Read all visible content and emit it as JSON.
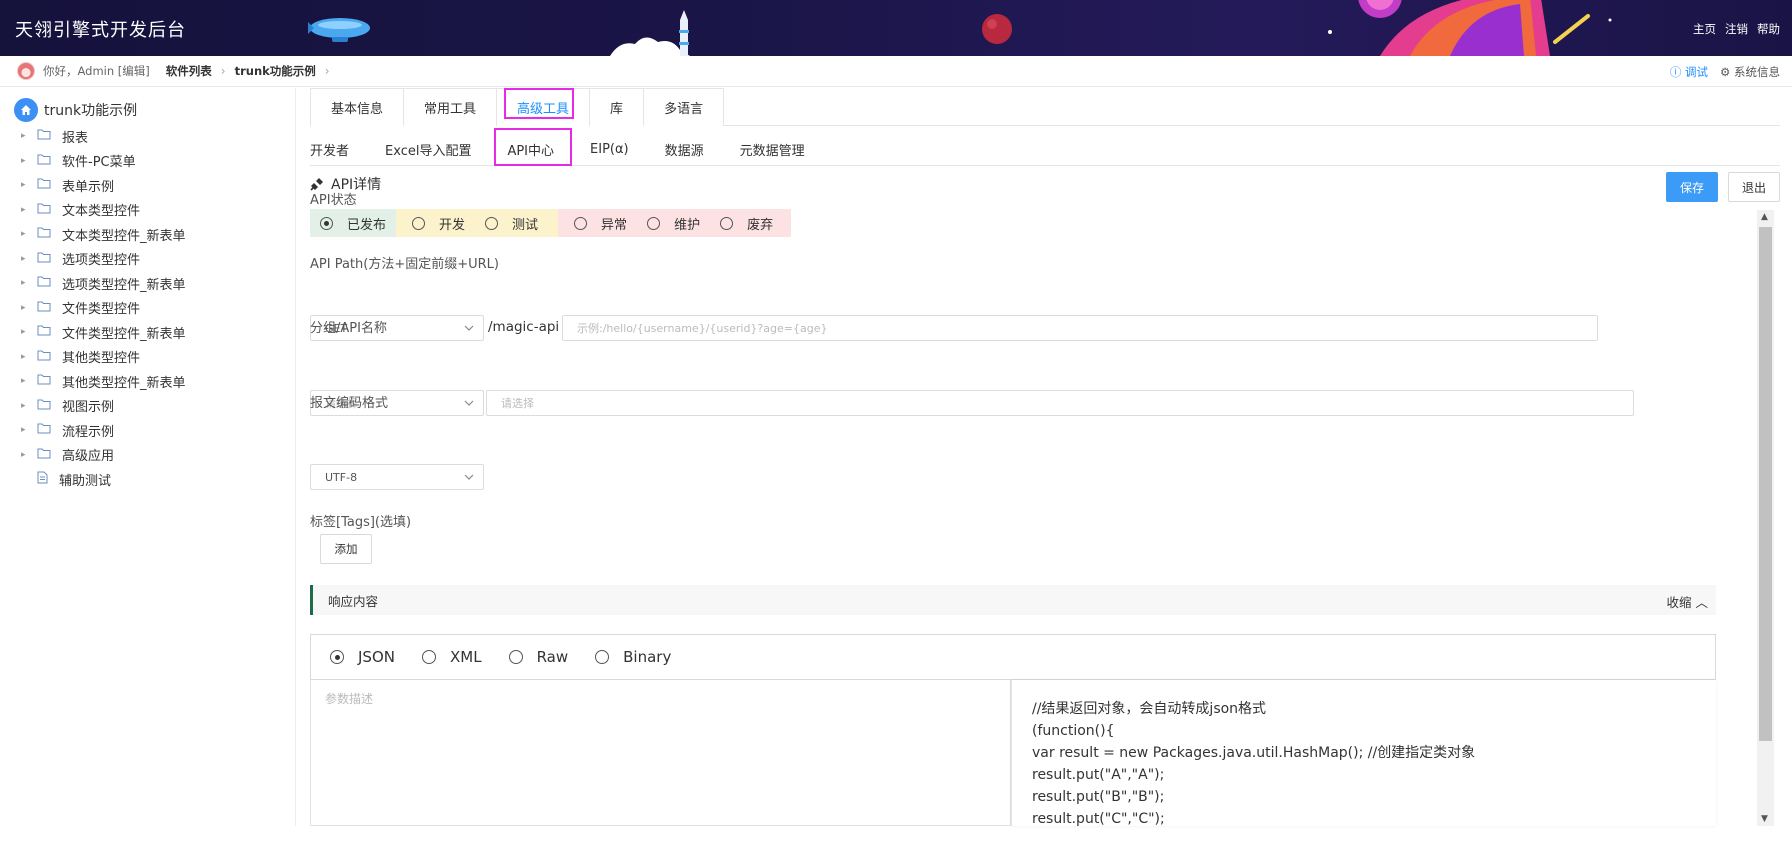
{
  "header": {
    "title": "天翎引擎式开发后台",
    "links": [
      "主页",
      "注销",
      "帮助"
    ]
  },
  "crumbbar": {
    "greeting": "你好，Admin [编辑]",
    "crumbs": [
      "软件列表",
      "trunk功能示例"
    ],
    "debug": "调试",
    "sysinfo": "系统信息"
  },
  "sidebar": {
    "root": "trunk功能示例",
    "items": [
      {
        "label": "报表",
        "type": "folder"
      },
      {
        "label": "软件-PC菜单",
        "type": "folder"
      },
      {
        "label": "表单示例",
        "type": "folder"
      },
      {
        "label": "文本类型控件",
        "type": "folder"
      },
      {
        "label": "文本类型控件_新表单",
        "type": "folder"
      },
      {
        "label": "选项类型控件",
        "type": "folder"
      },
      {
        "label": "选项类型控件_新表单",
        "type": "folder"
      },
      {
        "label": "文件类型控件",
        "type": "folder"
      },
      {
        "label": "文件类型控件_新表单",
        "type": "folder"
      },
      {
        "label": "其他类型控件",
        "type": "folder"
      },
      {
        "label": "其他类型控件_新表单",
        "type": "folder"
      },
      {
        "label": "视图示例",
        "type": "folder"
      },
      {
        "label": "流程示例",
        "type": "folder"
      },
      {
        "label": "高级应用",
        "type": "folder"
      },
      {
        "label": "辅助测试",
        "type": "file"
      }
    ]
  },
  "tabs_main": [
    "基本信息",
    "常用工具",
    "高级工具",
    "库",
    "多语言"
  ],
  "tabs_sub": [
    "开发者",
    "Excel导入配置",
    "API中心",
    "EIP(α)",
    "数据源",
    "元数据管理"
  ],
  "section": {
    "title": "API详情",
    "save": "保存",
    "exit": "退出"
  },
  "api_status": {
    "label": "API状态",
    "options": [
      "已发布",
      "开发",
      "测试",
      "异常",
      "维护",
      "废弃"
    ],
    "selected": "已发布"
  },
  "api_path": {
    "label": "API Path(方法+固定前缀+URL)",
    "method": "GET",
    "prefix": "/magic-api",
    "placeholder": "示例:/hello/{username}/{userid}?age={age}"
  },
  "group": {
    "label": "分组/API名称",
    "group_placeholder": "请选择",
    "name_placeholder": "请选择"
  },
  "encoding": {
    "label": "报文编码格式",
    "value": "UTF-8"
  },
  "tags": {
    "label": "标签[Tags](选填)",
    "add": "添加"
  },
  "response": {
    "title": "响应内容",
    "collapse": "收缩",
    "formats": [
      "JSON",
      "XML",
      "Raw",
      "Binary"
    ],
    "selected": "JSON",
    "desc_placeholder": "参数描述",
    "code_lines": [
      "//结果返回对象，会自动转成json格式",
      "(function(){",
      "var result = new Packages.java.util.HashMap(); //创建指定类对象",
      "result.put(\"A\",\"A\");",
      "result.put(\"B\",\"B\");",
      "result.put(\"C\",\"C\");"
    ]
  },
  "colors": {
    "header_bg": "#15123c",
    "accent": "#1890ff",
    "save_btn": "#3c9bf6",
    "highlight": "#e62ae6",
    "status_green": "#e3f0e8",
    "status_yellow": "#fcf3cd",
    "status_red": "#fde2e4"
  }
}
